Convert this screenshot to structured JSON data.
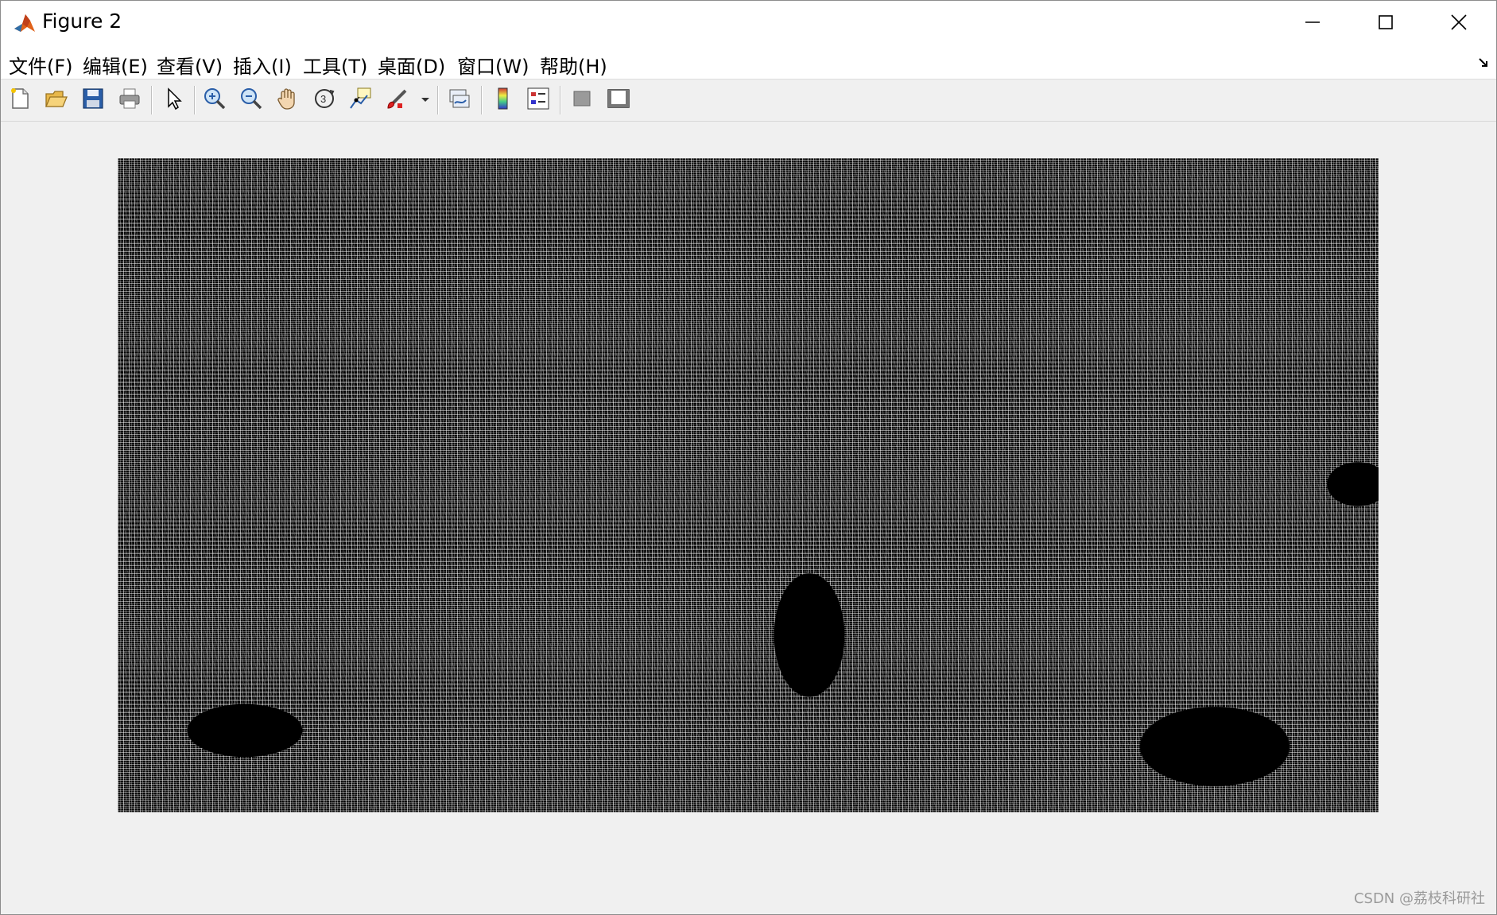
{
  "window": {
    "title": "Figure 2",
    "app_icon": "matlab-logo-icon",
    "controls": {
      "minimize_icon": "minimize-icon",
      "maximize_icon": "maximize-icon",
      "close_icon": "close-icon"
    }
  },
  "menubar": {
    "items": [
      {
        "label": "文件(F)"
      },
      {
        "label": "编辑(E)"
      },
      {
        "label": "查看(V)"
      },
      {
        "label": "插入(I)"
      },
      {
        "label": "工具(T)"
      },
      {
        "label": "桌面(D)"
      },
      {
        "label": "窗口(W)"
      },
      {
        "label": "帮助(H)"
      }
    ],
    "dock_icon": "dock-arrow-icon"
  },
  "toolbar": {
    "buttons": [
      {
        "icon": "new-figure-icon"
      },
      {
        "icon": "open-file-icon"
      },
      {
        "icon": "save-icon"
      },
      {
        "icon": "print-icon"
      },
      {
        "icon": "select-pointer-icon"
      },
      {
        "icon": "zoom-in-icon"
      },
      {
        "icon": "zoom-out-icon"
      },
      {
        "icon": "pan-hand-icon"
      },
      {
        "icon": "rotate-3d-icon"
      },
      {
        "icon": "data-cursor-icon"
      },
      {
        "icon": "brush-icon"
      },
      {
        "icon": "brush-dropdown-icon"
      },
      {
        "icon": "link-plot-icon"
      },
      {
        "icon": "colorbar-icon"
      },
      {
        "icon": "legend-icon"
      },
      {
        "icon": "hide-plot-tools-icon"
      },
      {
        "icon": "show-plot-tools-icon"
      }
    ]
  },
  "figure": {
    "image_description": "edge-detected grayscale image displayed in axes",
    "background_color": "#f0f0f0"
  },
  "watermark": {
    "text": "CSDN @荔枝科研社"
  }
}
